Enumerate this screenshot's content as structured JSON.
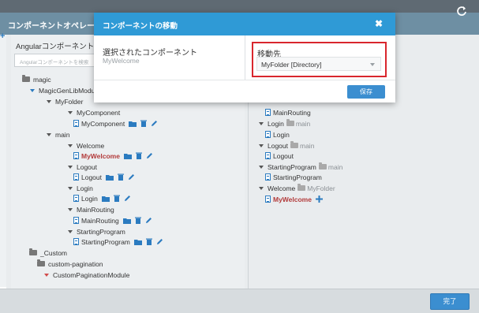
{
  "outer": {
    "title": "コンポーネントオペレー",
    "refresh_icon": "refresh-icon",
    "done_label": "完了",
    "left_plus": "+"
  },
  "left_panel": {
    "heading": "Angularコンポーネント",
    "search_placeholder": "Angularコンポーネントを検索",
    "tree": {
      "magic": "magic",
      "magic_gen": "MagicGenLibModule",
      "my_folder": "MyFolder",
      "my_component_folder": "MyComponent",
      "my_component_file": "MyComponent",
      "main": "main",
      "welcome_folder": "Welcome",
      "welcome_file": "MyWelcome",
      "logout_folder": "Logout",
      "logout_file": "Logout",
      "login_folder": "Login",
      "login_file": "Login",
      "mainrouting_folder": "MainRouting",
      "mainrouting_file": "MainRouting",
      "startingprogram_folder": "StartingProgram",
      "startingprogram_file": "StartingProgram",
      "custom": "_Custom",
      "custom_pagination": "custom-pagination",
      "custom_pagination_module": "CustomPaginationModule"
    }
  },
  "right_panel": {
    "items": {
      "mainrouting_file": "MainRouting",
      "login_folder": "Login",
      "login_parent": "main",
      "login_file": "Login",
      "logout_folder": "Logout",
      "logout_parent": "main",
      "logout_file": "Logout",
      "startingprogram_folder": "StartingProgram",
      "startingprogram_parent": "main",
      "startingprogram_file": "StartingProgram",
      "welcome_folder": "Welcome",
      "welcome_parent": "MyFolder",
      "welcome_file": "MyWelcome"
    }
  },
  "modal": {
    "title": "コンポーネントの移動",
    "close": "✖",
    "selected_label": "選択されたコンポーネント",
    "selected_value": "MyWelcome",
    "destination_label": "移動先",
    "destination_value": "MyFolder [Directory]",
    "save_label": "保存"
  },
  "colors": {
    "modal_header": "#2f9ad6",
    "outer_header": "#6e8fa3",
    "highlight": "#d9262d",
    "button": "#3b8ed0",
    "selected_text": "#b23a3a"
  }
}
